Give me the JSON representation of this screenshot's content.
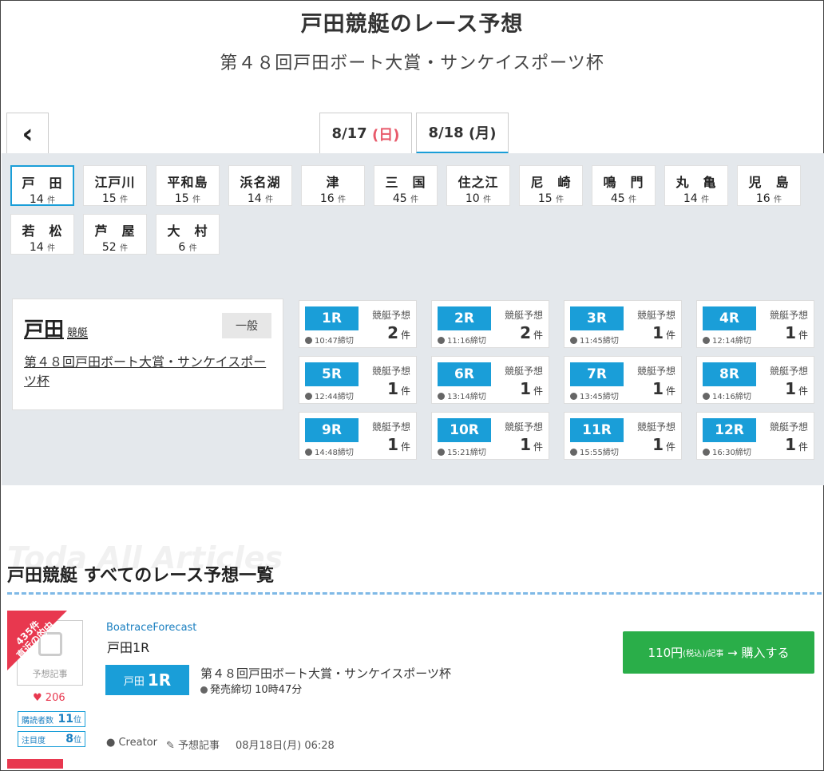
{
  "header": {
    "title": "戸田競艇のレース予想",
    "subtitle": "第４８回戸田ボート大賞・サンケイスポーツ杯"
  },
  "nav": {
    "back_glyph": "‹",
    "tabs": [
      {
        "date": "8/17",
        "dow": "(日)"
      },
      {
        "date": "8/18",
        "dow": "(月)"
      }
    ]
  },
  "venues": [
    {
      "name": "戸　田",
      "count": "14",
      "unit": "件"
    },
    {
      "name": "江戸川",
      "count": "15",
      "unit": "件"
    },
    {
      "name": "平和島",
      "count": "15",
      "unit": "件"
    },
    {
      "name": "浜名湖",
      "count": "14",
      "unit": "件"
    },
    {
      "name": "津",
      "count": "16",
      "unit": "件"
    },
    {
      "name": "三　国",
      "count": "45",
      "unit": "件"
    },
    {
      "name": "住之江",
      "count": "10",
      "unit": "件"
    },
    {
      "name": "尼　崎",
      "count": "15",
      "unit": "件"
    },
    {
      "name": "鳴　門",
      "count": "45",
      "unit": "件"
    },
    {
      "name": "丸　亀",
      "count": "14",
      "unit": "件"
    },
    {
      "name": "児　島",
      "count": "16",
      "unit": "件"
    },
    {
      "name": "若　松",
      "count": "14",
      "unit": "件"
    },
    {
      "name": "芦　屋",
      "count": "52",
      "unit": "件"
    },
    {
      "name": "大　村",
      "count": "6",
      "unit": "件"
    }
  ],
  "info": {
    "name": "戸田",
    "kind": "競艇",
    "badge": "一般",
    "race_title": "第４８回戸田ボート大賞・サンケイスポーツ杯"
  },
  "race_label": "競艇予想",
  "count_unit": "件",
  "races": [
    {
      "r": "1R",
      "time": "10:47締切",
      "count": "2"
    },
    {
      "r": "2R",
      "time": "11:16締切",
      "count": "2"
    },
    {
      "r": "3R",
      "time": "11:45締切",
      "count": "1"
    },
    {
      "r": "4R",
      "time": "12:14締切",
      "count": "1"
    },
    {
      "r": "5R",
      "time": "12:44締切",
      "count": "1"
    },
    {
      "r": "6R",
      "time": "13:14締切",
      "count": "1"
    },
    {
      "r": "7R",
      "time": "13:45締切",
      "count": "1"
    },
    {
      "r": "8R",
      "time": "14:16締切",
      "count": "1"
    },
    {
      "r": "9R",
      "time": "14:48締切",
      "count": "1"
    },
    {
      "r": "10R",
      "time": "15:21締切",
      "count": "1"
    },
    {
      "r": "11R",
      "time": "15:55締切",
      "count": "1"
    },
    {
      "r": "12R",
      "time": "16:30締切",
      "count": "1"
    }
  ],
  "section": {
    "bg_word": "Toda All Articles",
    "title": "戸田競艇 すべてのレース予想一覧"
  },
  "article": {
    "ribbon_line1": "435件",
    "ribbon_line2": "直近の的中",
    "thumb_label": "予想記事",
    "likes": "206",
    "rank1_label": "購読者数",
    "rank1_value": "11",
    "rank2_label": "注目度",
    "rank2_value": "8",
    "rank_unit": "位",
    "author": "BoatraceForecast",
    "title": "戸田1R",
    "pill_venue": "戸田",
    "pill_race": "1R",
    "race_name": "第４８回戸田ボート大賞・サンケイスポーツ杯",
    "deadline": "発売締切 10時47分",
    "buy_price": "110円",
    "buy_tax": "(税込)/記事",
    "buy_action": "→ 購入する",
    "meta_creator": "Creator",
    "meta_type": "予想記事",
    "meta_date": "08月18日(月) 06:28"
  }
}
